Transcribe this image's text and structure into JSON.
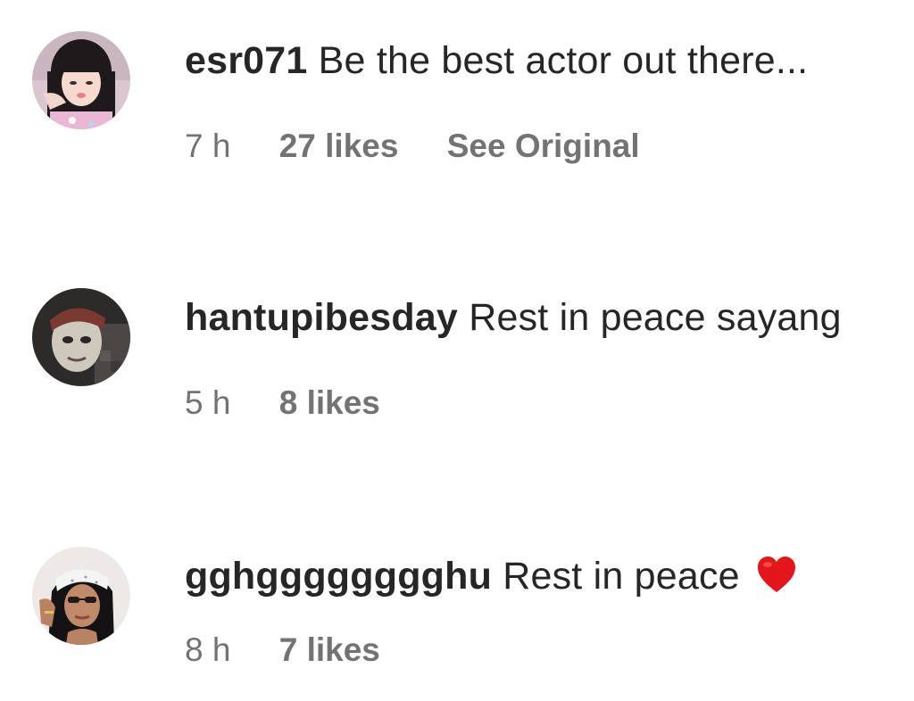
{
  "comments": [
    {
      "avatar": "avatar-girl-pink",
      "username": "esr071",
      "text": "Be the best actor out there...",
      "time": "7 h",
      "likes": "27 likes",
      "see_original": "See Original"
    },
    {
      "avatar": "avatar-masked-face",
      "username": "hantupibesday",
      "text": "Rest in peace sayang",
      "time": "5 h",
      "likes": "8 likes"
    },
    {
      "avatar": "avatar-woman-bandana",
      "username": "gghgggggggghu",
      "text": "Rest in peace",
      "emoji": "red-heart",
      "time": "8 h",
      "likes": "7 likes"
    }
  ],
  "colors": {
    "primary_text": "#262626",
    "secondary_text": "#737373",
    "heart": "#e3161b",
    "background": "#ffffff"
  }
}
